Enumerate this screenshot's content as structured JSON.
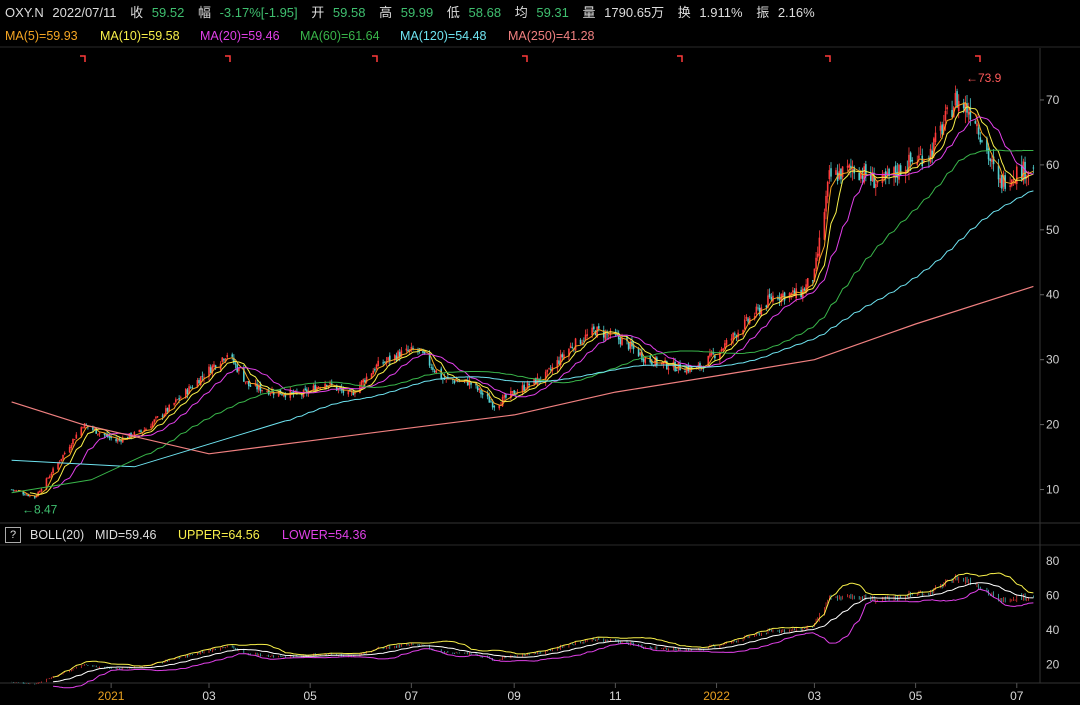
{
  "header": {
    "symbol": "OXY.N",
    "date": "2022/07/11",
    "close_label": "收",
    "close_value": "59.52",
    "change_label": "幅",
    "change_value": "-3.17%[-1.95]",
    "open_label": "开",
    "open_value": "59.58",
    "high_label": "高",
    "high_value": "59.99",
    "low_label": "低",
    "low_value": "58.68",
    "avg_label": "均",
    "avg_value": "59.31",
    "volume_label": "量",
    "volume_value": "1790.65万",
    "turnover_label": "换",
    "turnover_value": "1.911%",
    "amplitude_label": "振",
    "amplitude_value": "2.16%"
  },
  "ma_legend": [
    {
      "text": "MA(5)=59.93",
      "color": "#f5a623"
    },
    {
      "text": "MA(10)=59.58",
      "color": "#f8f04a"
    },
    {
      "text": "MA(20)=59.46",
      "color": "#e040e8"
    },
    {
      "text": "MA(60)=61.64",
      "color": "#39b54a"
    },
    {
      "text": "MA(120)=54.48",
      "color": "#6ee3f0"
    },
    {
      "text": "MA(250)=41.28",
      "color": "#f08080"
    }
  ],
  "boll_legend": {
    "icon": "?",
    "name": "BOLL(20)",
    "mid": "MID=59.46",
    "upper": "UPPER=64.56",
    "lower": "LOWER=54.36"
  },
  "colors": {
    "up": "#ff3b3b",
    "down": "#50d0d0",
    "text_green": "#3fbf6f",
    "axis_text": "#cfcfcf",
    "month_text": "#d9d9d9",
    "year_text": "#e8a020"
  },
  "chart_data": [
    {
      "type": "candlestick",
      "title": "",
      "y_axis": {
        "ticks": [
          10,
          20,
          30,
          40,
          50,
          60,
          70
        ],
        "range": [
          5,
          78
        ]
      },
      "x_ticks": [
        "2021",
        "03",
        "05",
        "07",
        "09",
        "11",
        "2022",
        "03",
        "05",
        "07"
      ],
      "annotations": [
        {
          "text": "←8.47",
          "x": "2020-11",
          "y": 8.47
        },
        {
          "text": "←73.9",
          "x": "2022-05",
          "y": 73.9
        }
      ],
      "close_path": [
        [
          "2020-11-02",
          10.0
        ],
        [
          "2020-11-16",
          8.8
        ],
        [
          "2020-12-01",
          14.5
        ],
        [
          "2020-12-15",
          20.0
        ],
        [
          "2021-01-04",
          17.5
        ],
        [
          "2021-01-20",
          19.0
        ],
        [
          "2021-02-05",
          22.5
        ],
        [
          "2021-02-25",
          27.5
        ],
        [
          "2021-03-12",
          31.0
        ],
        [
          "2021-03-25",
          26.0
        ],
        [
          "2021-04-10",
          25.0
        ],
        [
          "2021-04-25",
          24.5
        ],
        [
          "2021-05-10",
          26.5
        ],
        [
          "2021-05-25",
          24.5
        ],
        [
          "2021-06-10",
          29.0
        ],
        [
          "2021-06-25",
          31.0
        ],
        [
          "2021-07-05",
          31.5
        ],
        [
          "2021-07-20",
          27.0
        ],
        [
          "2021-08-05",
          26.5
        ],
        [
          "2021-08-20",
          23.0
        ],
        [
          "2021-09-05",
          25.5
        ],
        [
          "2021-09-20",
          27.5
        ],
        [
          "2021-10-05",
          32.0
        ],
        [
          "2021-10-20",
          34.5
        ],
        [
          "2021-11-05",
          33.0
        ],
        [
          "2021-11-20",
          30.0
        ],
        [
          "2021-12-05",
          29.0
        ],
        [
          "2021-12-20",
          28.5
        ],
        [
          "2022-01-05",
          32.0
        ],
        [
          "2022-01-20",
          36.0
        ],
        [
          "2022-02-05",
          40.0
        ],
        [
          "2022-02-20",
          40.0
        ],
        [
          "2022-03-01",
          43.0
        ],
        [
          "2022-03-10",
          58.0
        ],
        [
          "2022-03-25",
          59.5
        ],
        [
          "2022-04-10",
          57.0
        ],
        [
          "2022-04-25",
          60.0
        ],
        [
          "2022-05-10",
          62.0
        ],
        [
          "2022-05-25",
          70.0
        ],
        [
          "2022-06-05",
          68.0
        ],
        [
          "2022-06-20",
          57.0
        ],
        [
          "2022-07-01",
          59.0
        ],
        [
          "2022-07-11",
          59.52
        ]
      ],
      "series": [
        {
          "name": "MA(5)",
          "color": "#f5a623",
          "last": 59.93
        },
        {
          "name": "MA(10)",
          "color": "#f8f04a",
          "last": 59.58
        },
        {
          "name": "MA(20)",
          "color": "#e040e8",
          "last": 59.46
        },
        {
          "name": "MA(60)",
          "color": "#39b54a",
          "last": 61.64
        },
        {
          "name": "MA(120)",
          "color": "#6ee3f0",
          "last": 54.48
        },
        {
          "name": "MA(250)",
          "color": "#f08080",
          "last": 41.28,
          "points": [
            [
              "2020-11-02",
              23.5
            ],
            [
              "2020-12-15",
              20.0
            ],
            [
              "2021-03-01",
              15.5
            ],
            [
              "2021-05-01",
              17.5
            ],
            [
              "2021-07-01",
              19.5
            ],
            [
              "2021-09-01",
              21.5
            ],
            [
              "2021-11-01",
              25.0
            ],
            [
              "2022-01-01",
              27.5
            ],
            [
              "2022-03-01",
              30.0
            ],
            [
              "2022-05-01",
              35.5
            ],
            [
              "2022-07-11",
              41.28
            ]
          ]
        }
      ]
    },
    {
      "type": "line",
      "title": "",
      "y_axis": {
        "ticks": [
          20,
          40,
          60,
          80
        ],
        "range": [
          10,
          88
        ]
      },
      "series": [
        {
          "name": "MID",
          "color": "#ffffff",
          "last": 59.46
        },
        {
          "name": "UPPER",
          "color": "#f8f04a",
          "last": 64.56
        },
        {
          "name": "LOWER",
          "color": "#e040e8",
          "last": 54.36
        }
      ]
    }
  ]
}
